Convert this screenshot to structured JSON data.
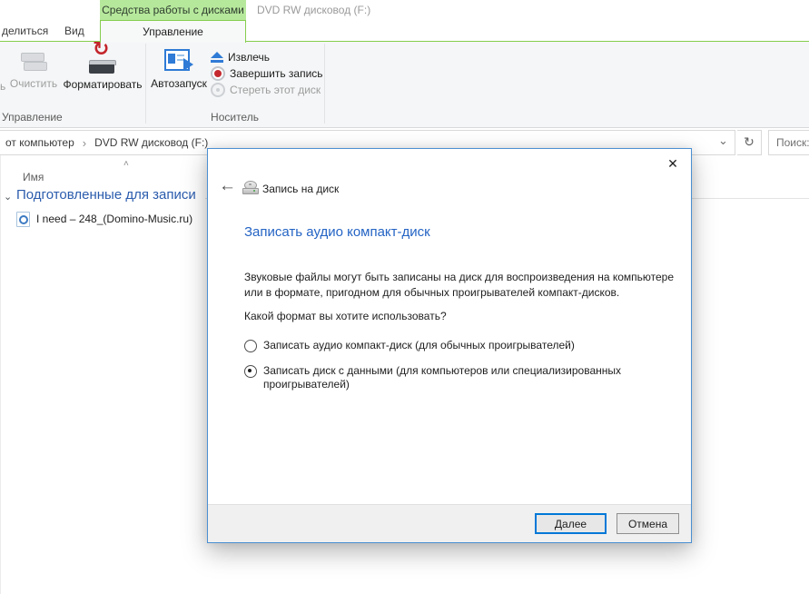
{
  "window": {
    "contextual_group": "Средства работы с дисками",
    "title": "DVD RW дисковод (F:)"
  },
  "ribbon": {
    "tabs": {
      "share_partial": "делиться",
      "view": "Вид",
      "manage": "Управление"
    },
    "buttons": {
      "partial": "ь",
      "clean": "Очистить",
      "format": "Форматировать",
      "autoplay": "Автозапуск",
      "eject": "Извлечь",
      "finish_burn": "Завершить запись",
      "erase": "Стереть этот диск"
    },
    "groups": {
      "manage": "Управление",
      "media": "Носитель"
    }
  },
  "address_bar": {
    "breadcrumb_root": "от компьютер",
    "separator": "›",
    "breadcrumb_current": "DVD RW дисковод (F:)",
    "search_label": "Поиск:"
  },
  "file_list": {
    "column_name": "Имя",
    "group_header": "Подготовленные для записи",
    "files": [
      {
        "name": "I need – 248_(Domino-Music.ru)"
      }
    ]
  },
  "dialog": {
    "title": "Запись на диск",
    "heading": "Записать аудио компакт-диск",
    "description": "Звуковые файлы могут быть записаны на диск для воспроизведения на компьютере или в формате, пригодном для обычных проигрывателей компакт-дисков.",
    "question": "Какой формат вы хотите использовать?",
    "options": [
      {
        "label": "Записать аудио компакт-диск (для обычных проигрывателей)",
        "selected": false
      },
      {
        "label": "Записать диск с данными (для компьютеров или специализированных проигрывателей)",
        "selected": true
      }
    ],
    "buttons": {
      "next": "Далее",
      "cancel": "Отмена"
    }
  },
  "icons": {
    "back": "←",
    "close": "✕",
    "refresh": "↻",
    "dropdown": "⌄",
    "sort_asc": "˄",
    "group_chevron": "⌄"
  },
  "colors": {
    "contextual_green": "#b6e89c",
    "ribbon_green_border": "#86ce4e",
    "heading_blue": "#2464c4",
    "group_header_blue": "#2b5cad",
    "accent_button_border": "#0078d7",
    "dialog_border_blue": "#4a8fd2"
  }
}
